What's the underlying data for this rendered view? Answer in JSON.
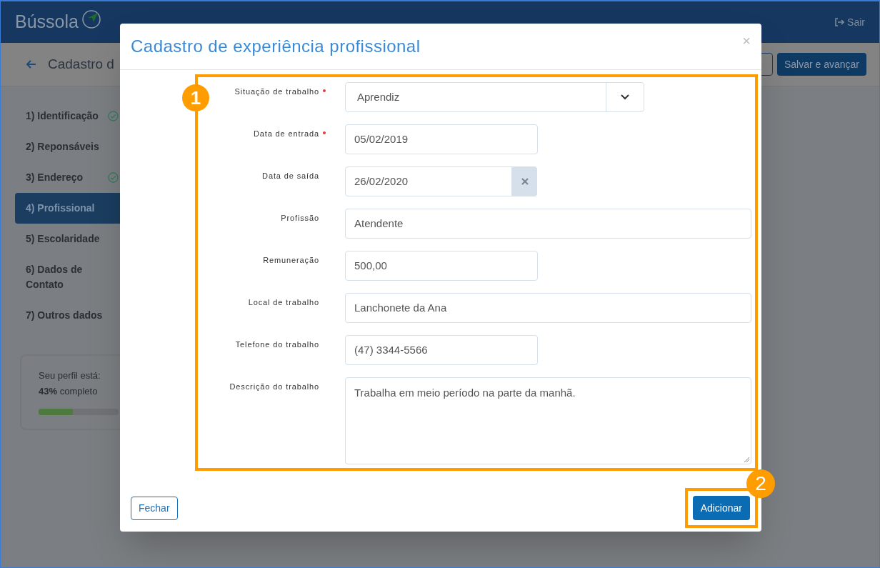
{
  "header": {
    "logo": "Bússola",
    "logout": "Sair"
  },
  "page": {
    "title": "Cadastro d",
    "save_button": "Salvar e avançar"
  },
  "sidebar": {
    "items": [
      {
        "label": "1) Identificação",
        "selected": false,
        "done": true
      },
      {
        "label": "2) Reponsáveis",
        "selected": false,
        "done": false
      },
      {
        "label": "3) Endereço",
        "selected": false,
        "done": true
      },
      {
        "label": "4) Profissional",
        "selected": true,
        "done": false
      },
      {
        "label": "5) Escolaridade",
        "selected": false,
        "done": false
      },
      {
        "label": "6) Dados de Contato",
        "selected": false,
        "done": false
      },
      {
        "label": "7) Outros dados",
        "selected": false,
        "done": false
      }
    ],
    "progress": {
      "caption": "Seu perfil está:",
      "percent": "43%",
      "suffix": "completo",
      "level": 0.43
    }
  },
  "modal": {
    "title": "Cadastro de experiência profissional",
    "close": "×",
    "form_marker": "1",
    "fields": [
      {
        "kind": "select",
        "label": "Situação de trabalho",
        "required": true,
        "value": "Aprendiz"
      },
      {
        "kind": "short",
        "label": "Data de entrada",
        "required": true,
        "value": "05/02/2019"
      },
      {
        "kind": "date",
        "label": "Data de saída",
        "required": false,
        "value": "26/02/2020"
      },
      {
        "kind": "long",
        "label": "Profissão",
        "required": false,
        "value": "Atendente"
      },
      {
        "kind": "short",
        "label": "Remuneração",
        "required": false,
        "value": "500,00"
      },
      {
        "kind": "long",
        "label": "Local de trabalho",
        "required": false,
        "value": "Lanchonete da Ana"
      },
      {
        "kind": "short",
        "label": "Telefone do trabalho",
        "required": false,
        "value": "(47) 3344-5566"
      },
      {
        "kind": "textarea",
        "label": "Descrição do trabalho",
        "required": false,
        "value": "Trabalha em meio período na parte da manhã."
      }
    ],
    "close_button": "Fechar",
    "add_marker": "2",
    "add_button": "Adicionar"
  }
}
